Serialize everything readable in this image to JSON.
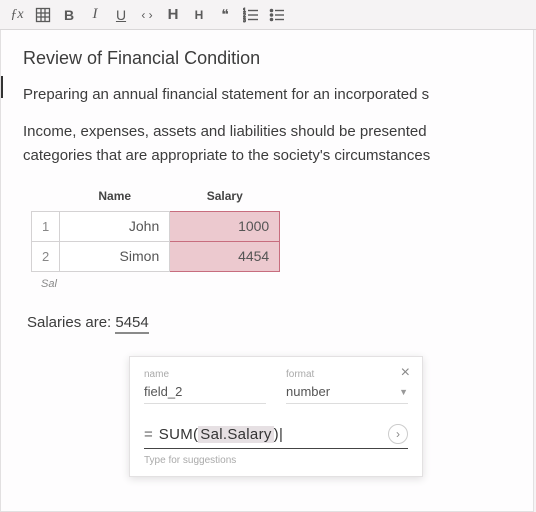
{
  "toolbar": {
    "fx": "ƒx",
    "bold": "B",
    "italic": "I",
    "underline": "U",
    "code": "‹ ›",
    "h1": "H",
    "h2": "H",
    "quote": "❝",
    "ol": "≡",
    "ul": "≡"
  },
  "doc": {
    "heading": "Review of Financial Condition",
    "p1": "Preparing an annual financial statement for an incorporated s",
    "p2a": "Income, expenses, assets and liabilities should be presented",
    "p2b": "categories that are appropriate to the society's circumstances",
    "table": {
      "cols": [
        "Name",
        "Salary"
      ],
      "rows": [
        {
          "n": "1",
          "name": "John",
          "salary": "1000"
        },
        {
          "n": "2",
          "name": "Simon",
          "salary": "4454"
        }
      ],
      "caption": "Sal"
    },
    "result_label": "Salaries are: ",
    "result_value": "5454"
  },
  "popover": {
    "name_label": "name",
    "name_value": "field_2",
    "format_label": "format",
    "format_value": "number",
    "eq": "=",
    "fn": "SUM(",
    "arg": "Sal.Salary",
    "fn_close": ")",
    "hint": "Type for suggestions"
  }
}
